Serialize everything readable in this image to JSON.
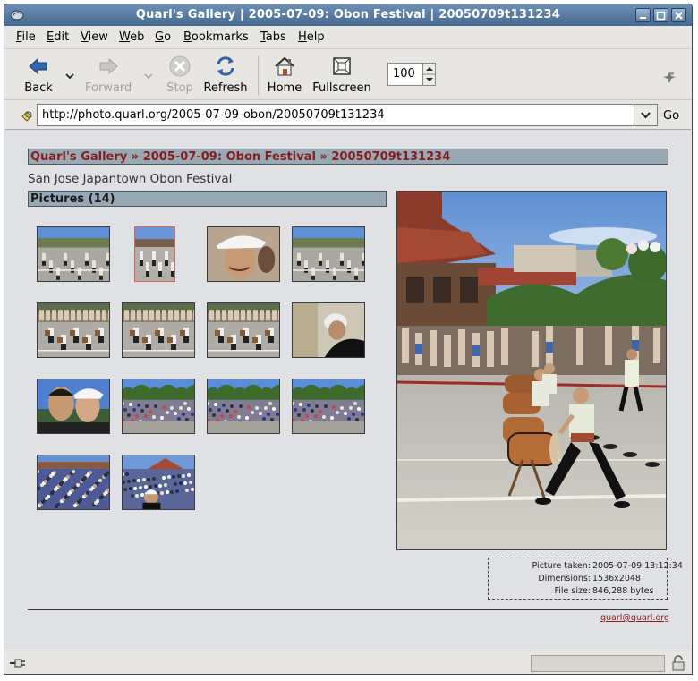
{
  "window": {
    "title": "Quarl's Gallery | 2005-07-09: Obon Festival | 20050709t131234"
  },
  "menu": [
    "File",
    "Edit",
    "View",
    "Web",
    "Go",
    "Bookmarks",
    "Tabs",
    "Help"
  ],
  "toolbar": {
    "back": "Back",
    "forward": "Forward",
    "stop": "Stop",
    "refresh": "Refresh",
    "home": "Home",
    "fullscreen": "Fullscreen",
    "zoom": "100"
  },
  "location": {
    "url": "http://photo.quarl.org/2005-07-09-obon/20050709t131234",
    "go": "Go"
  },
  "page": {
    "breadcrumb": {
      "root": "Quarl's Gallery",
      "sep1": " » ",
      "album": "2005-07-09: Obon Festival",
      "sep2": " » ",
      "current": "20050709t131234"
    },
    "subtitle": "San Jose Japantown Obon Festival",
    "pictures_heading": "Pictures (14)",
    "thumbnails": [
      {
        "name": "thumb-1",
        "scene": "parade-street"
      },
      {
        "name": "thumb-2",
        "scene": "parade-street-selected",
        "selected": true
      },
      {
        "name": "thumb-3",
        "scene": "portrait-cap"
      },
      {
        "name": "thumb-4",
        "scene": "parade-street"
      },
      {
        "name": "thumb-5",
        "scene": "dancers-street"
      },
      {
        "name": "thumb-6",
        "scene": "dancers-street"
      },
      {
        "name": "thumb-7",
        "scene": "dancers-street"
      },
      {
        "name": "thumb-8",
        "scene": "profile-cap"
      },
      {
        "name": "thumb-9",
        "scene": "couple-selfie"
      },
      {
        "name": "thumb-10",
        "scene": "crowd-trees"
      },
      {
        "name": "thumb-11",
        "scene": "crowd-trees"
      },
      {
        "name": "thumb-12",
        "scene": "crowd-trees"
      },
      {
        "name": "thumb-13",
        "scene": "crowd-dense"
      },
      {
        "name": "thumb-14",
        "scene": "crowd-woman"
      }
    ],
    "photo_info": {
      "taken_label": "Picture taken:",
      "taken": "2005-07-09 13:12:34",
      "dimensions_label": "Dimensions:",
      "dimensions": "1536x2048",
      "filesize_label": "File size:",
      "filesize": "846,288 bytes"
    },
    "footer_email": "quarl@quarl.org"
  },
  "colors": {
    "title_bar": "#46698f",
    "heading_bar": "#97a9b5",
    "link": "#8b1a1a",
    "content_bg": "#dfe1e5"
  }
}
